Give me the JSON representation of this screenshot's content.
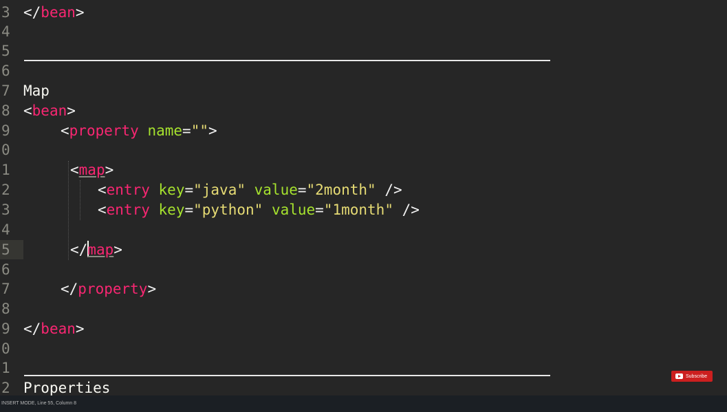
{
  "line_numbers": [
    "3",
    "4",
    "5",
    "6",
    "7",
    "8",
    "9",
    "0",
    "1",
    "2",
    "3",
    "4",
    "5",
    "6",
    "7",
    "8",
    "9",
    "0",
    "1",
    "2"
  ],
  "code": {
    "l3": {
      "open": "</",
      "tag": "bean",
      "close": ">"
    },
    "l7": {
      "text": "Map"
    },
    "l8": {
      "open": "<",
      "tag": "bean",
      "close": ">"
    },
    "l9": {
      "open": "<",
      "tag": "property",
      "sp": " ",
      "attr": "name",
      "eq": "=",
      "val": "\"\"",
      "close": ">"
    },
    "l11": {
      "open": "<",
      "tag": "map",
      "close": ">"
    },
    "l12": {
      "open": "<",
      "tag": "entry",
      "sp1": " ",
      "attr1": "key",
      "eq1": "=",
      "val1": "\"java\"",
      "sp2": " ",
      "attr2": "value",
      "eq2": "=",
      "val2": "\"2month\"",
      "close": " />"
    },
    "l13": {
      "open": "<",
      "tag": "entry",
      "sp1": " ",
      "attr1": "key",
      "eq1": "=",
      "val1": "\"python\"",
      "sp2": " ",
      "attr2": "value",
      "eq2": "=",
      "val2": "\"1month\"",
      "close": " />"
    },
    "l15": {
      "open": "</",
      "tag": "map",
      "close": ">"
    },
    "l17": {
      "open": "</",
      "tag": "property",
      "close": ">"
    },
    "l19": {
      "open": "</",
      "tag": "bean",
      "close": ">"
    },
    "l22": {
      "text": "Properties"
    }
  },
  "status_bar": {
    "text": "INSERT MODE, Line 55, Column 8"
  },
  "subscribe": {
    "label": "Subscribe"
  },
  "colors": {
    "background": "#262626",
    "tag": "#f92672",
    "attribute": "#a6e22e",
    "string": "#e6db74",
    "text": "#f2f2f2",
    "youtube_red": "#cc1f1f"
  }
}
